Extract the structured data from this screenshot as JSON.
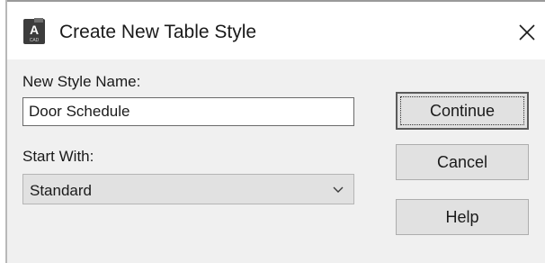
{
  "window": {
    "title": "Create New Table Style",
    "icon": "autocad-app-icon",
    "icon_letter": "A",
    "icon_subtext": "CAD",
    "close_glyph": "✕"
  },
  "form": {
    "name_label": "New Style Name:",
    "name_value": "Door Schedule",
    "start_label": "Start With:",
    "start_value": "Standard"
  },
  "buttons": {
    "continue_label": "Continue",
    "cancel_label": "Cancel",
    "help_label": "Help"
  },
  "colors": {
    "client_bg": "#f0f0f0",
    "button_bg": "#e1e1e1",
    "border": "#adadad"
  }
}
